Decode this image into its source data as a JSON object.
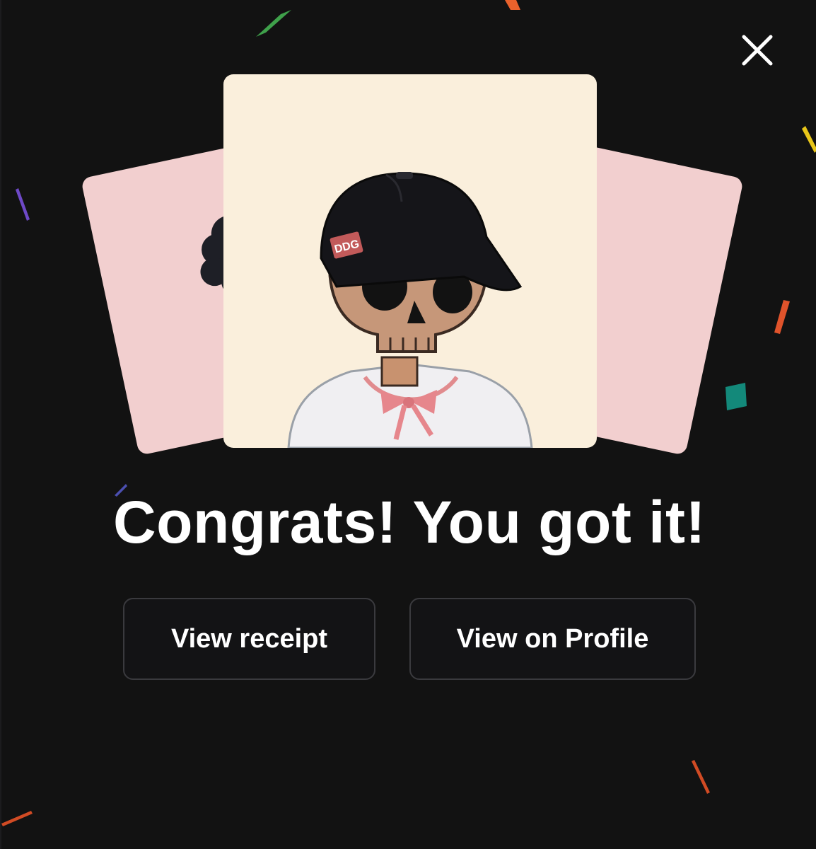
{
  "modal": {
    "headline": "Congrats! You got it!",
    "close_icon": "close-icon",
    "buttons": {
      "view_receipt": "View receipt",
      "view_on_profile": "View on Profile"
    }
  },
  "nft": {
    "main_card_badge": "DDG",
    "card_colors": {
      "center": "#faefdc",
      "side": "#f2cfcf"
    }
  },
  "colors": {
    "background": "#121212",
    "button_border": "#3a3a3e",
    "text": "#ffffff"
  }
}
